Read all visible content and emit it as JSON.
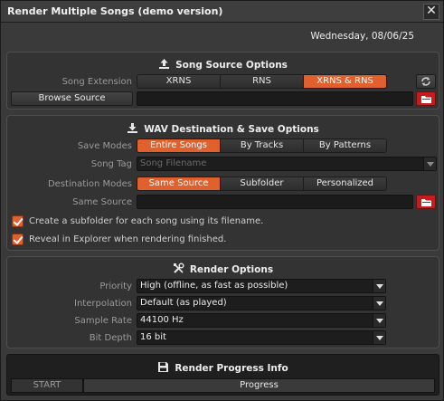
{
  "window": {
    "title": "Render Multiple Songs  (demo version)",
    "close_label": "✕",
    "date": "Wednesday, 08/06/25"
  },
  "song_source": {
    "title": "Song Source Options",
    "icon": "upload-icon",
    "extension_label": "Song Extension",
    "extension_options": [
      "XRNS",
      "RNS",
      "XRNS & RNS"
    ],
    "extension_selected": "XRNS & RNS",
    "browse_label": "Browse Source",
    "source_path": ""
  },
  "wav_dest": {
    "title": "WAV Destination & Save Options",
    "icon": "download-icon",
    "save_modes_label": "Save Modes",
    "save_modes": [
      "Entire Songs",
      "By Tracks",
      "By Patterns"
    ],
    "save_mode_selected": "Entire Songs",
    "song_tag_label": "Song Tag",
    "song_tag_value": "Song Filename",
    "dest_modes_label": "Destination Modes",
    "dest_modes": [
      "Same Source",
      "Subfolder",
      "Personalized"
    ],
    "dest_mode_selected": "Same Source",
    "same_source_label": "Same Source",
    "same_source_path": "",
    "create_subfolder_label": "Create a subfolder for each song using its filename.",
    "create_subfolder_checked": true,
    "reveal_label": "Reveal in Explorer when rendering finished.",
    "reveal_checked": true
  },
  "render": {
    "title": "Render Options",
    "icon": "tools-icon",
    "priority_label": "Priority",
    "priority_value": "High (offline, as fast as possible)",
    "interpolation_label": "Interpolation",
    "interpolation_value": "Default (as played)",
    "sample_rate_label": "Sample Rate",
    "sample_rate_value": "44100 Hz",
    "bit_depth_label": "Bit Depth",
    "bit_depth_value": "16 bit"
  },
  "progress": {
    "title": "Render Progress Info",
    "icon": "save-disk-icon",
    "start_label": "START",
    "progress_label": "Progress"
  },
  "colors": {
    "accent": "#e0602e",
    "folder_button": "#c81c1c",
    "background": "#3a3a3a"
  }
}
